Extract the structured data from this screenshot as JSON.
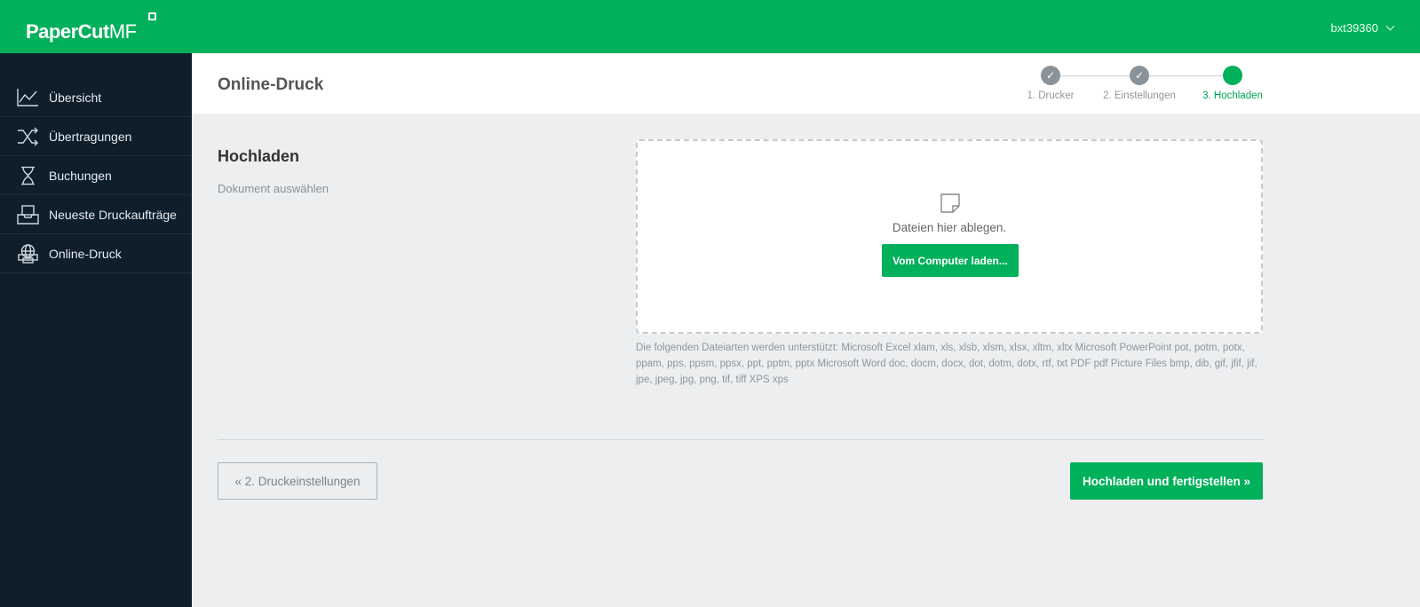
{
  "app": {
    "logo_text": "PaperCut",
    "logo_suffix": "MF",
    "user": "bxt39360",
    "brand_color": "#00b05a"
  },
  "sidebar": {
    "items": [
      {
        "label": "Übersicht",
        "icon": "line-chart-icon"
      },
      {
        "label": "Übertragungen",
        "icon": "shuffle-icon"
      },
      {
        "label": "Buchungen",
        "icon": "hourglass-icon"
      },
      {
        "label": "Neueste Druckaufträge",
        "icon": "inbox-tray-icon"
      },
      {
        "label": "Online-Druck",
        "icon": "globe-printer-icon"
      }
    ]
  },
  "header": {
    "title": "Online-Druck",
    "steps": [
      {
        "label": "1. Drucker",
        "status": "done"
      },
      {
        "label": "2. Einstellungen",
        "status": "done"
      },
      {
        "label": "3. Hochladen",
        "status": "current"
      }
    ]
  },
  "main": {
    "section_title": "Hochladen",
    "section_subtitle": "Dokument auswählen",
    "drop_text": "Dateien hier ablegen.",
    "browse_label": "Vom Computer laden...",
    "supported_text": "Die folgenden Dateiarten werden unterstützt: Microsoft Excel xlam, xls, xlsb, xlsm, xlsx, xltm, xltx Microsoft PowerPoint pot, potm, potx, ppam, pps, ppsm, ppsx, ppt, pptm, pptx Microsoft Word doc, docm, docx, dot, dotm, dotx, rtf, txt PDF pdf Picture Files bmp, dib, gif, jfif, jif, jpe, jpeg, jpg, png, tif, tiff XPS xps"
  },
  "footer": {
    "back_label": "« 2. Druckeinstellungen",
    "finish_label": "Hochladen und fertigstellen »"
  }
}
